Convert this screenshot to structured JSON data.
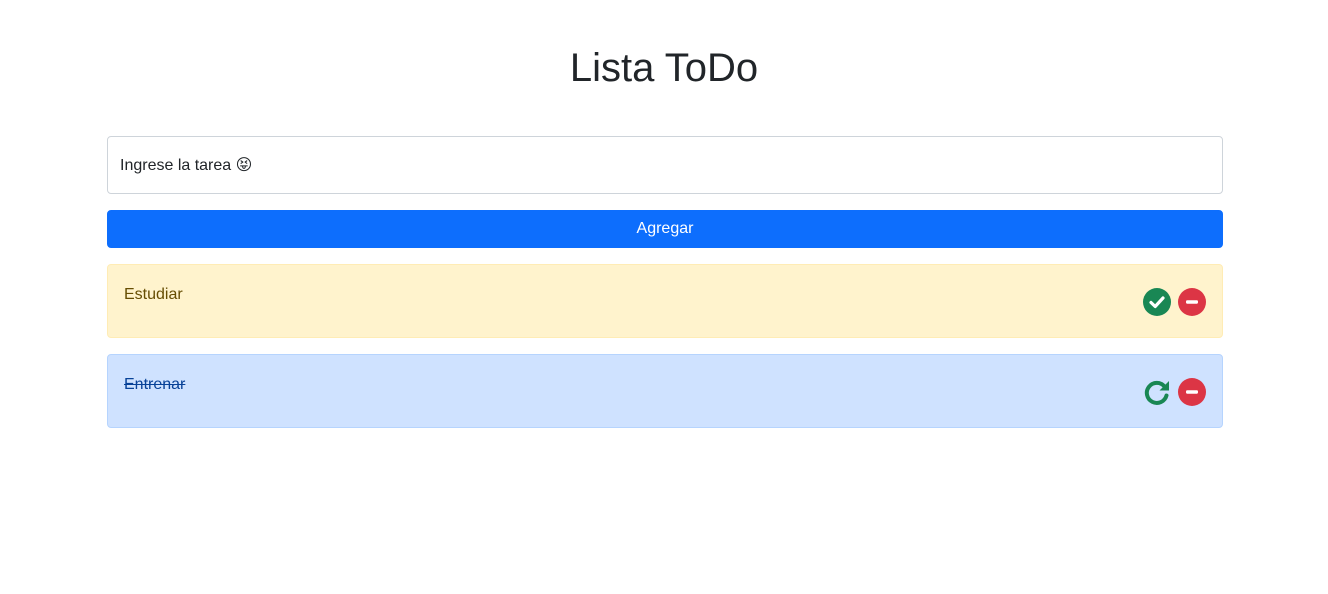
{
  "header": {
    "title": "Lista ToDo"
  },
  "form": {
    "input_value": "Ingrese la tarea 😝",
    "add_label": "Agregar"
  },
  "tasks": [
    {
      "label": "Estudiar",
      "status": "pending",
      "primary_icon": "check-circle-icon",
      "secondary_icon": "minus-circle-icon"
    },
    {
      "label": "Entrenar",
      "status": "done",
      "primary_icon": "redo-icon",
      "secondary_icon": "minus-circle-icon"
    }
  ],
  "colors": {
    "primary": "#0d6efd",
    "success": "#198754",
    "danger": "#dc3545",
    "warning_bg": "#fff3cd",
    "info_bg": "#cfe2ff"
  }
}
